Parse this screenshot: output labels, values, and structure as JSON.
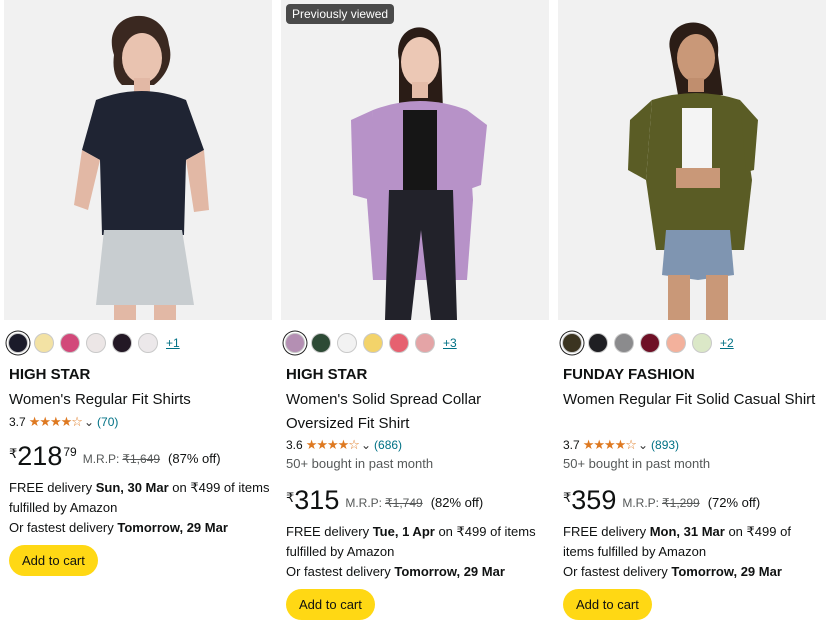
{
  "colors": {
    "accent_star": "#de7921",
    "link": "#007185",
    "button_bg": "#ffd814",
    "badge_bg": "#4a4a4a"
  },
  "products": [
    {
      "badge": "",
      "swatches": [
        "#1b1b2a",
        "#f3e2a4",
        "#d2497a",
        "#ece6e6",
        "#231825",
        "#ece8ea"
      ],
      "more_colors": "+1",
      "brand": "HIGH STAR",
      "title": "Women's Regular Fit Shirts",
      "rating": "3.7",
      "stars": "★★★★☆",
      "reviews": "(70)",
      "bought": "",
      "currency": "₹",
      "price_whole": "218",
      "price_fraction": "79",
      "mrp_label": "M.R.P:",
      "mrp": "₹1,649",
      "discount": "(87% off)",
      "delivery_prefix": "FREE delivery ",
      "delivery_date": "Sun, 30 Mar",
      "delivery_suffix": " on ₹499 of items fulfilled by Amazon",
      "fastest_prefix": "Or fastest delivery ",
      "fastest_date": "Tomorrow, 29 Mar",
      "add_to_cart": "Add to cart"
    },
    {
      "badge": "Previously viewed",
      "swatches": [
        "#b48fb3",
        "#2d4a35",
        "#f2f2f2",
        "#f3d36a",
        "#e66170",
        "#e4a4a6"
      ],
      "more_colors": "+3",
      "brand": "HIGH STAR",
      "title": "Women's Solid Spread Collar Oversized Fit Shirt",
      "rating": "3.6",
      "stars": "★★★★☆",
      "reviews": "(686)",
      "bought": "50+ bought in past month",
      "currency": "₹",
      "price_whole": "315",
      "price_fraction": "",
      "mrp_label": "M.R.P:",
      "mrp": "₹1,749",
      "discount": "(82% off)",
      "delivery_prefix": "FREE delivery ",
      "delivery_date": "Tue, 1 Apr",
      "delivery_suffix": " on ₹499 of items fulfilled by Amazon",
      "fastest_prefix": "Or fastest delivery ",
      "fastest_date": "Tomorrow, 29 Mar",
      "add_to_cart": "Add to cart"
    },
    {
      "badge": "",
      "swatches": [
        "#3b3420",
        "#1f1f23",
        "#8b8b8d",
        "#6e1026",
        "#f3b19c",
        "#dbe8c7"
      ],
      "more_colors": "+2",
      "brand": "FUNDAY FASHION",
      "title": "Women Regular Fit Solid Casual Shirt",
      "rating": "3.7",
      "stars": "★★★★☆",
      "reviews": "(893)",
      "bought": "50+ bought in past month",
      "currency": "₹",
      "price_whole": "359",
      "price_fraction": "",
      "mrp_label": "M.R.P:",
      "mrp": "₹1,299",
      "discount": "(72% off)",
      "delivery_prefix": "FREE delivery ",
      "delivery_date": "Mon, 31 Mar",
      "delivery_suffix": " on ₹499 of items fulfilled by Amazon",
      "fastest_prefix": "Or fastest delivery ",
      "fastest_date": "Tomorrow, 29 Mar",
      "add_to_cart": "Add to cart"
    }
  ]
}
